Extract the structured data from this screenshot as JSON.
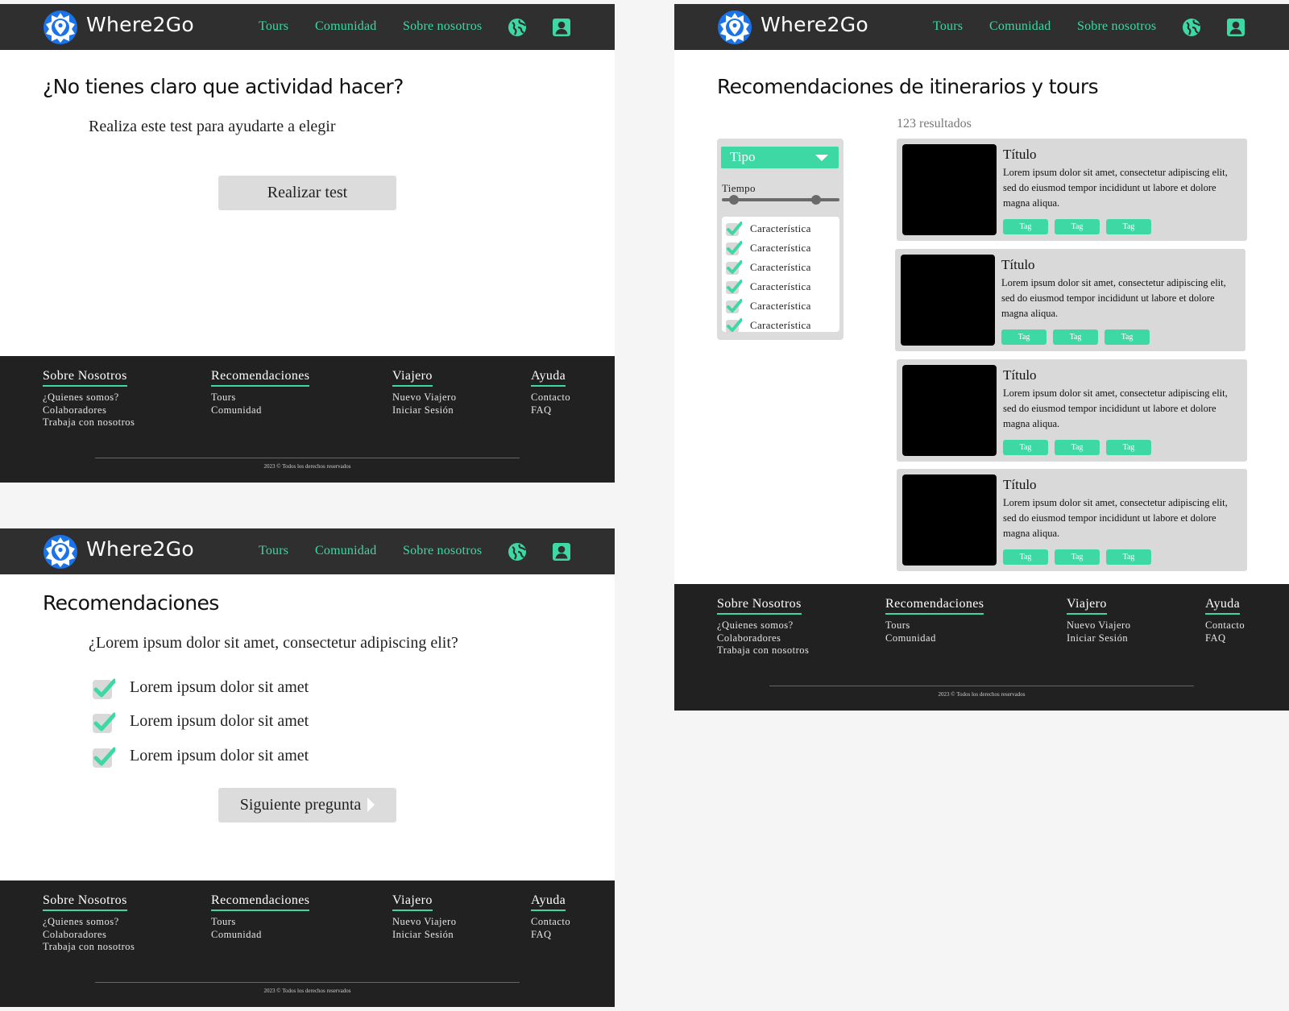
{
  "header": {
    "brand": "Where2Go",
    "nav": [
      "Tours",
      "Comunidad",
      "Sobre nosotros"
    ],
    "icons": [
      "logo-pin-icon",
      "globe-icon",
      "user-account-icon"
    ]
  },
  "colors": {
    "accent": "#3dd8a4",
    "header_bg": "#2f2f2f",
    "footer_bg": "#212121",
    "logo_blue": "#1a73e8"
  },
  "test_page": {
    "title": "¿No tienes claro que actividad hacer?",
    "subtitle": "Realiza este test para ayudarte a elegir",
    "button": "Realizar test"
  },
  "question_page": {
    "title": "Recomendaciones",
    "question": "¿Lorem ipsum dolor sit amet, consectetur adipiscing elit?",
    "options": [
      "Lorem ipsum dolor sit amet",
      "Lorem ipsum dolor sit amet",
      "Lorem ipsum dolor sit amet"
    ],
    "next_button": "Siguiente pregunta"
  },
  "results_page": {
    "title": "Recomendaciones de itinerarios y tours",
    "result_count": "123 resultados",
    "filter": {
      "type_label": "Tipo",
      "time_label": "Tiempo",
      "characteristics": [
        "Característica",
        "Característica",
        "Característica",
        "Característica",
        "Característica",
        "Característica"
      ]
    },
    "cards": [
      {
        "title": "Título",
        "description": "Lorem ipsum dolor sit amet, consectetur adipiscing elit, sed do eiusmod tempor incididunt ut labore et dolore magna aliqua.",
        "tags": [
          "Tag",
          "Tag",
          "Tag"
        ]
      },
      {
        "title": "Título",
        "description": "Lorem ipsum dolor sit amet, consectetur adipiscing elit, sed do eiusmod tempor incididunt ut labore et dolore magna aliqua.",
        "tags": [
          "Tag",
          "Tag",
          "Tag"
        ]
      },
      {
        "title": "Título",
        "description": "Lorem ipsum dolor sit amet, consectetur adipiscing elit, sed do eiusmod tempor incididunt ut labore et dolore magna aliqua.",
        "tags": [
          "Tag",
          "Tag",
          "Tag"
        ]
      },
      {
        "title": "Título",
        "description": "Lorem ipsum dolor sit amet, consectetur adipiscing elit, sed do eiusmod tempor incididunt ut labore et dolore magna aliqua.",
        "tags": [
          "Tag",
          "Tag",
          "Tag"
        ]
      }
    ]
  },
  "footer": {
    "columns": [
      {
        "heading": "Sobre Nosotros",
        "links": [
          "¿Quienes somos?",
          "Colaboradores",
          "Trabaja con nosotros"
        ]
      },
      {
        "heading": "Recomendaciones",
        "links": [
          "Tours",
          "Comunidad"
        ]
      },
      {
        "heading": "Viajero",
        "links": [
          "Nuevo Viajero",
          "Iniciar Sesión"
        ]
      },
      {
        "heading": "Ayuda",
        "links": [
          "Contacto",
          "FAQ"
        ]
      }
    ],
    "copyright": "2023 © Todos los derechos reservados"
  }
}
